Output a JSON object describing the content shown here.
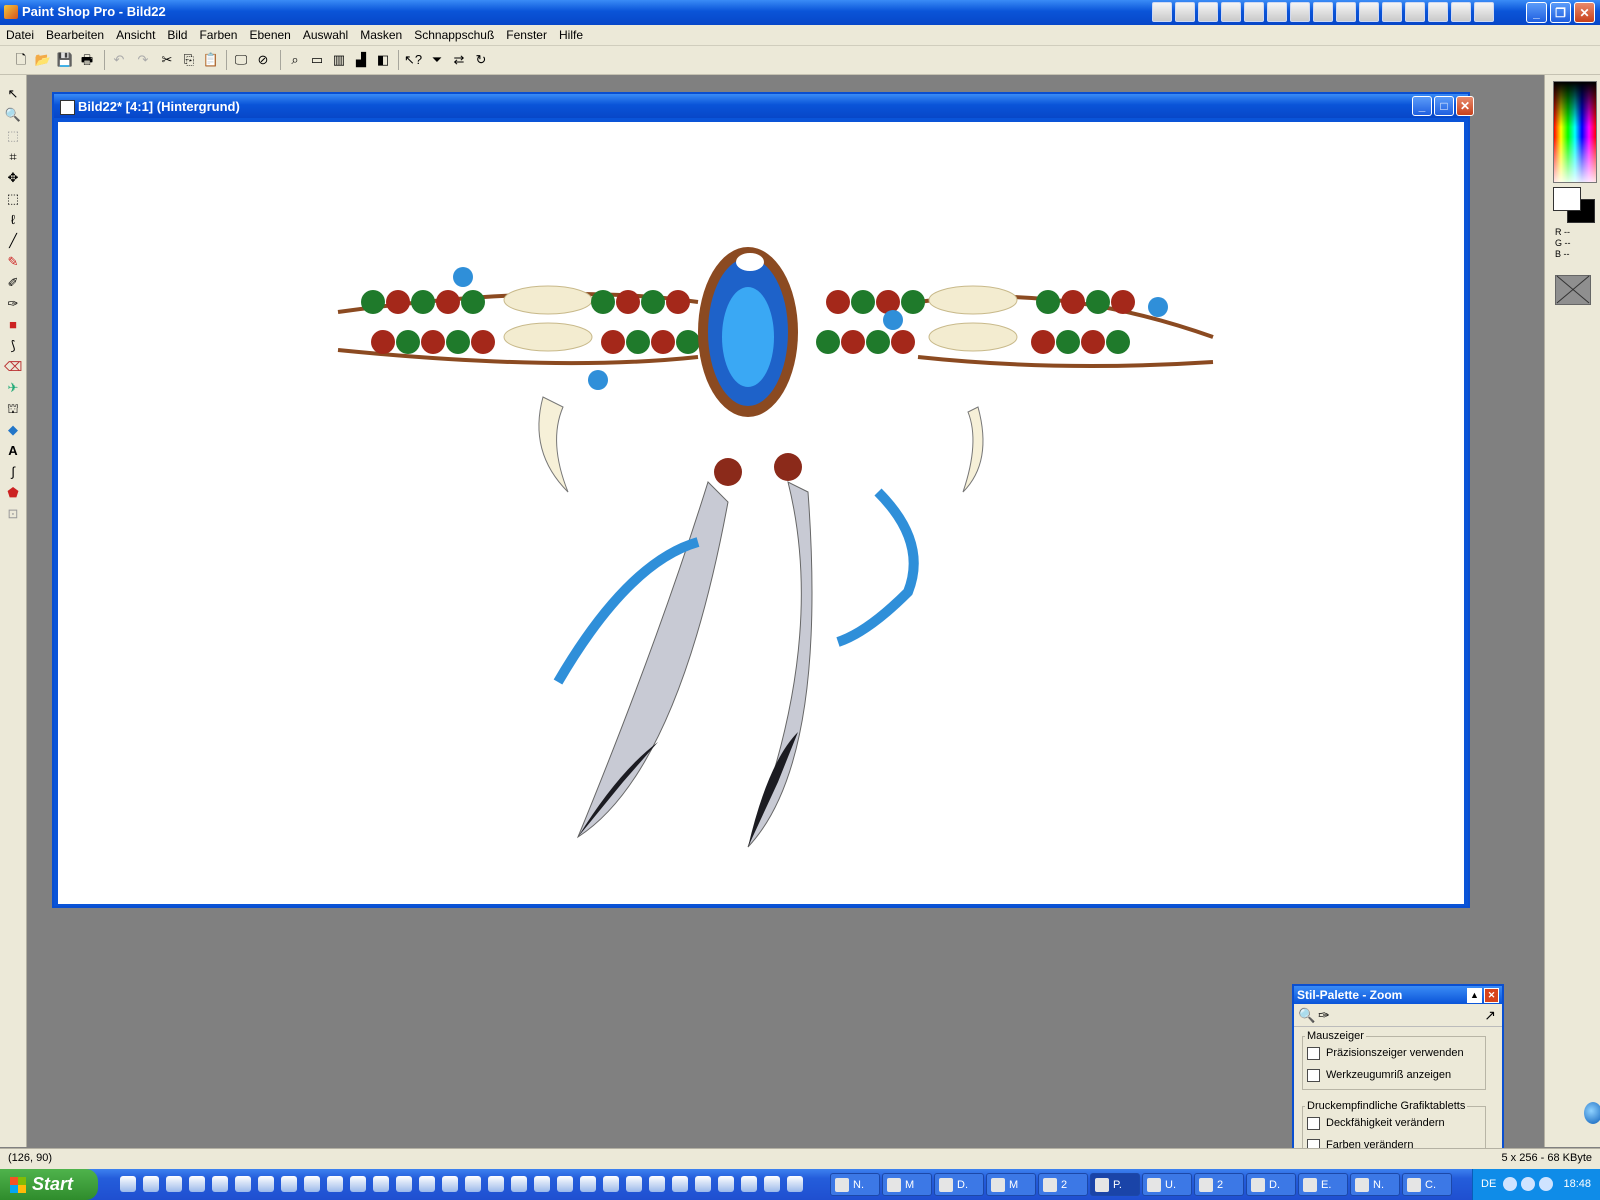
{
  "app": {
    "title": "Paint Shop Pro - Bild22"
  },
  "menu": [
    "Datei",
    "Bearbeiten",
    "Ansicht",
    "Bild",
    "Farben",
    "Ebenen",
    "Auswahl",
    "Masken",
    "Schnappschuß",
    "Fenster",
    "Hilfe"
  ],
  "image_window": {
    "title": "Bild22* [4:1] (Hintergrund)"
  },
  "color_palette": {
    "foreground": "#ffffff",
    "background": "#000000",
    "rgb_labels": [
      "R --",
      "G --",
      "B --"
    ]
  },
  "stil_palette": {
    "title": "Stil-Palette - Zoom",
    "group1": {
      "legend": "Mauszeiger",
      "options": [
        "Präzisionszeiger verwenden",
        "Werkzeugumriß anzeigen"
      ]
    },
    "group2": {
      "legend": "Druckempfindliche Grafiktabletts",
      "options": [
        "Deckfähigkeit verändern",
        "Farben verändern"
      ]
    }
  },
  "status": {
    "coords": "(126, 90)",
    "image_info": "5 x 256 - 68 KByte"
  },
  "taskbar": {
    "start_label": "Start",
    "tasks": [
      "N.",
      "M",
      "D.",
      "M",
      "2",
      "P.",
      "U.",
      "2",
      "D.",
      "E.",
      "N.",
      "C."
    ],
    "language": "DE",
    "clock": "18:48"
  },
  "colors": {
    "xp_blue": "#0a54d8",
    "chrome": "#ece9d8",
    "workspace": "#808080"
  }
}
